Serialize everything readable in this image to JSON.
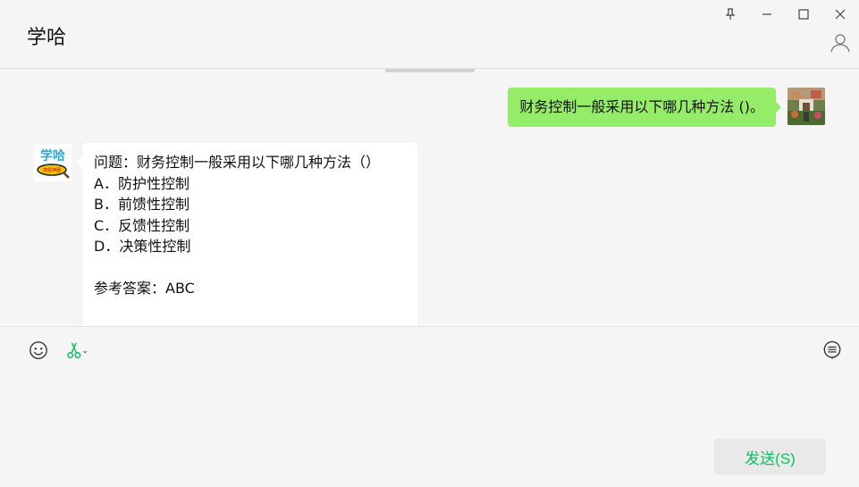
{
  "window": {
    "title": "学哈"
  },
  "icons": {
    "pin": "pin-icon",
    "minimize": "minimize-icon",
    "maximize": "maximize-icon",
    "close": "close-icon",
    "profile": "profile-icon",
    "emoji": "emoji-icon",
    "screenshot": "scissors-icon",
    "history": "chat-history-icon"
  },
  "messages": {
    "outgoing": {
      "text": "财务控制一般采用以下哪几种方法 ()。"
    },
    "incoming": {
      "question": "问题：财务控制一般采用以下哪几种方法（）",
      "options": [
        "A．防护性控制",
        "B．前馈性控制",
        "C．反馈性控制",
        "D．决策性控制"
      ],
      "answer": "参考答案：ABC"
    },
    "bot_avatar_text": "学哈",
    "bot_avatar_subtext": "搜题神器"
  },
  "composer": {
    "value": "",
    "send_label": "发送(S)"
  },
  "colors": {
    "outgoing_bubble": "#95ec69",
    "incoming_bubble": "#ffffff",
    "send_text": "#07c160",
    "background": "#f5f5f5"
  }
}
